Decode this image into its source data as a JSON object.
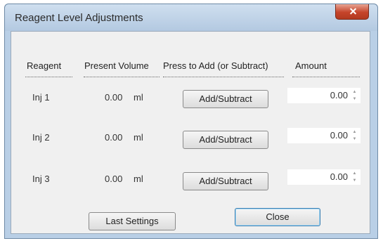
{
  "window": {
    "title": "Reagent Level Adjustments"
  },
  "headers": {
    "reagent": "Reagent",
    "present_volume": "Present Volume",
    "press_to_add": "Press to Add (or Subtract)",
    "amount": "Amount"
  },
  "rows": [
    {
      "reagent": "Inj 1",
      "volume": "0.00",
      "unit": "ml",
      "button": "Add/Subtract",
      "amount": "0.00"
    },
    {
      "reagent": "Inj 2",
      "volume": "0.00",
      "unit": "ml",
      "button": "Add/Subtract",
      "amount": "0.00"
    },
    {
      "reagent": "Inj 3",
      "volume": "0.00",
      "unit": "ml",
      "button": "Add/Subtract",
      "amount": "0.00"
    }
  ],
  "buttons": {
    "last_settings": "Last Settings",
    "close": "Close"
  },
  "icons": {
    "close": "close-icon",
    "spin_up": "spin-up-icon",
    "spin_down": "spin-down-icon"
  },
  "colors": {
    "title_bar": "#b9cfe6",
    "close_button": "#c5442a",
    "dialog_bg": "#f0f0f0"
  }
}
